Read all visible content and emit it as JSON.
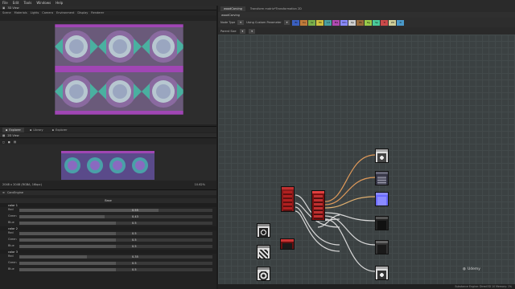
{
  "menubar": {
    "items": [
      "File",
      "Edit",
      "Tools",
      "Windows",
      "Help"
    ]
  },
  "viewport3d": {
    "title": "3D View",
    "menu": [
      "Scene",
      "Materials",
      "Lights",
      "Camera",
      "Environment",
      "Display",
      "Renderer"
    ]
  },
  "tabs": [
    {
      "label": "Explorer",
      "active": true
    },
    {
      "label": "Library",
      "active": false
    },
    {
      "label": "Explorer",
      "active": false
    }
  ],
  "bitmap": {
    "title": "2D View",
    "status_left": "2048 x 2048 (RGBA, 16bpc)",
    "zoom": "10.62%"
  },
  "params": {
    "title": "CarvEngine",
    "section": "Base",
    "groups": [
      {
        "name": "color 1",
        "rows": [
          {
            "label": "Red",
            "value": "0.55",
            "fill": 0.72
          },
          {
            "label": "Green",
            "value": "0.43",
            "fill": 0.44
          },
          {
            "label": "Blue",
            "value": "0.5",
            "fill": 0.5
          }
        ]
      },
      {
        "name": "color 2",
        "rows": [
          {
            "label": "Red",
            "value": "0.5",
            "fill": 0.5
          },
          {
            "label": "Green",
            "value": "0.5",
            "fill": 0.5
          },
          {
            "label": "Blue",
            "value": "0.5",
            "fill": 0.5
          }
        ]
      },
      {
        "name": "color 3",
        "rows": [
          {
            "label": "Red",
            "value": "0.35",
            "fill": 0.35
          },
          {
            "label": "Green",
            "value": "0.5",
            "fill": 0.5
          },
          {
            "label": "Blue",
            "value": "0.5",
            "fill": 0.5
          }
        ]
      }
    ]
  },
  "graph": {
    "tabs": [
      "woodCarving",
      "Transform matrix*Transformation 2D"
    ],
    "path": "woodCarving",
    "node_type_label": "Node Type",
    "custom_param_label": "Using Custom Parameter",
    "parent_size_label": "Parent Size"
  },
  "swatches": [
    {
      "label": "Bl",
      "color": "#3a5fbf"
    },
    {
      "label": "Cu",
      "color": "#c07a3a"
    },
    {
      "label": "Gr",
      "color": "#7ab04a"
    },
    {
      "label": "Hb",
      "color": "#d0c040"
    },
    {
      "label": "Ld",
      "color": "#4aa0a0"
    },
    {
      "label": "Ma",
      "color": "#b04ab0"
    },
    {
      "label": "Nm",
      "color": "#8a8aff"
    },
    {
      "label": "Op",
      "color": "#cfcfcf"
    },
    {
      "label": "Pb",
      "color": "#9a6a3a"
    },
    {
      "label": "Rg",
      "color": "#9acb4a"
    },
    {
      "label": "Sp",
      "color": "#4acb9a"
    },
    {
      "label": "Tr",
      "color": "#cb4a4a"
    },
    {
      "label": "Wt",
      "color": "#cfcf9a"
    },
    {
      "label": "Xr",
      "color": "#4a9acb"
    }
  ],
  "watermark": "Udemy",
  "status": "Substance Engine: Direct3D 10   Memory: 1%"
}
